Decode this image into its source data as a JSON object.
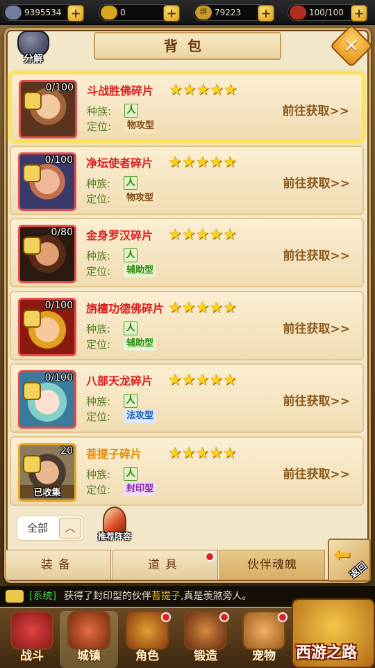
{
  "topbar": {
    "silver": "9395534",
    "gold": "0",
    "bound_label": "绑",
    "bound_gold": "79223",
    "stamina": "100/100"
  },
  "panel": {
    "title": "背包",
    "decompose_label": "分解"
  },
  "items": [
    {
      "name": "斗战胜佛碎片",
      "count": "0/100",
      "stars": 5,
      "race_label": "种族:",
      "race": "人",
      "role_label": "定位:",
      "role": "物攻型",
      "goto": "前往获取>>"
    },
    {
      "name": "净坛使者碎片",
      "count": "0/100",
      "stars": 5,
      "race_label": "种族:",
      "race": "人",
      "role_label": "定位:",
      "role": "物攻型",
      "goto": "前往获取>>"
    },
    {
      "name": "金身罗汉碎片",
      "count": "0/80",
      "stars": 5,
      "race_label": "种族:",
      "race": "人",
      "role_label": "定位:",
      "role": "辅助型",
      "goto": "前往获取>>"
    },
    {
      "name": "旃檀功德佛碎片",
      "count": "0/100",
      "stars": 5,
      "race_label": "种族:",
      "race": "人",
      "role_label": "定位:",
      "role": "辅助型",
      "goto": "前往获取>>"
    },
    {
      "name": "八部天龙碎片",
      "count": "0/100",
      "stars": 5,
      "race_label": "种族:",
      "race": "人",
      "role_label": "定位:",
      "role": "法攻型",
      "goto": "前往获取>>"
    },
    {
      "name": "菩提子碎片",
      "count": "20",
      "stars": 5,
      "race_label": "种族:",
      "race": "人",
      "role_label": "定位:",
      "role": "封印型",
      "goto": "前往获取>>",
      "collected": "已收集"
    }
  ],
  "filter": {
    "label": "全部",
    "arrow": "^"
  },
  "recommend_label": "推荐阵容",
  "tabs": [
    {
      "label": "装备",
      "active": false
    },
    {
      "label": "道具",
      "active": false,
      "badge": true
    },
    {
      "label": "伙伴魂魄",
      "active": true
    }
  ],
  "back_label": "返回",
  "chat": {
    "channel": "[系统]",
    "prefix": "获得了封印型的伙伴",
    "highlight": "菩提子",
    "suffix": ",真是羡煞旁人。"
  },
  "nav": [
    {
      "label": "战斗",
      "badge": false
    },
    {
      "label": "城镇",
      "badge": false,
      "active": true
    },
    {
      "label": "角色",
      "badge": true
    },
    {
      "label": "锻造",
      "badge": true
    },
    {
      "label": "宠物",
      "badge": true
    }
  ],
  "logo": "西游之路",
  "colors": {
    "panel_bg": "#f3e7c9",
    "name_red": "#d81e1e",
    "name_gold": "#e38a00",
    "star": "#ffd21a",
    "system_green": "#3cd63c"
  }
}
